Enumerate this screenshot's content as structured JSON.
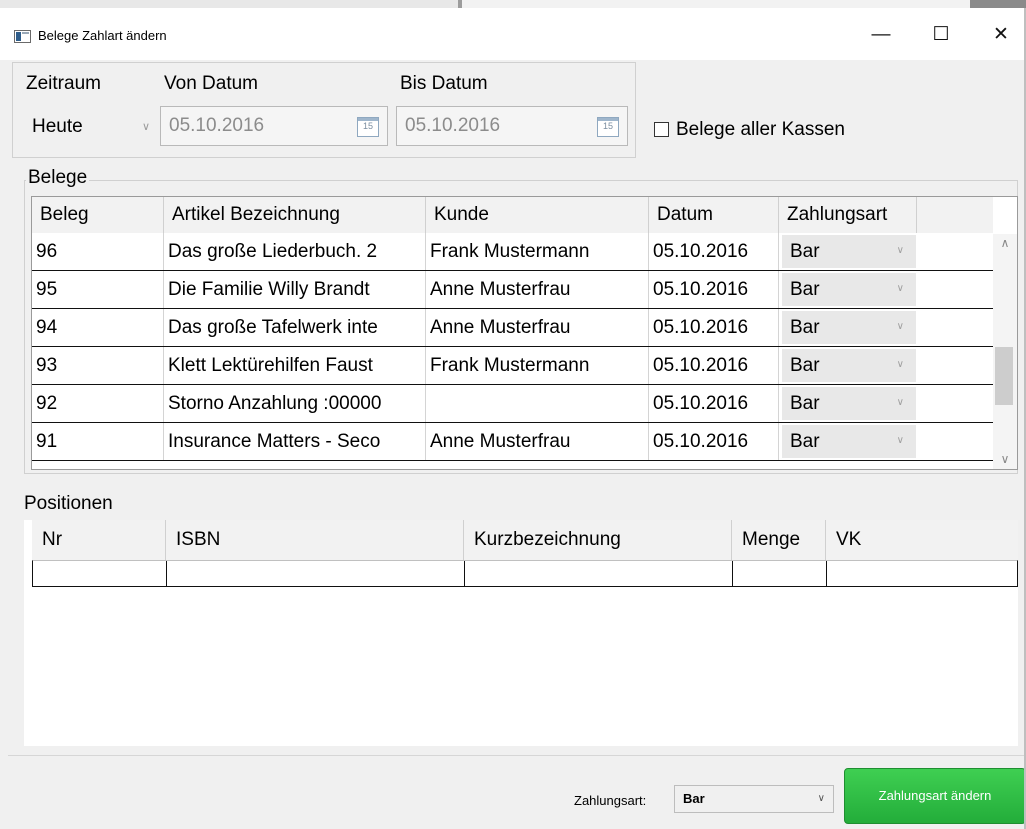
{
  "window": {
    "title": "Belege Zahlart ändern",
    "minimize_glyph": "—",
    "maximize_glyph": "☐",
    "close_glyph": "✕",
    "icon": "app-window-icon"
  },
  "filter": {
    "zeitraum_label": "Zeitraum",
    "von_label": "Von Datum",
    "bis_label": "Bis Datum",
    "zeitraum_value": "Heute",
    "von_value": "05.10.2016",
    "bis_value": "05.10.2016",
    "calendar_icon_text": "15",
    "alle_kassen_label": "Belege aller Kassen",
    "alle_kassen_checked": false
  },
  "belege": {
    "title": "Belege",
    "columns": [
      "Beleg",
      "Artikel Bezeichnung",
      "Kunde",
      "Datum",
      "Zahlungsart"
    ],
    "rows": [
      {
        "beleg": "96",
        "artikel": "Das große Liederbuch. 2",
        "kunde": "Frank Mustermann",
        "datum": "05.10.2016",
        "zahlungsart": "Bar"
      },
      {
        "beleg": "95",
        "artikel": "Die Familie Willy Brandt",
        "kunde": "Anne Musterfrau",
        "datum": "05.10.2016",
        "zahlungsart": "Bar"
      },
      {
        "beleg": "94",
        "artikel": "Das große Tafelwerk inte",
        "kunde": "Anne Musterfrau",
        "datum": "05.10.2016",
        "zahlungsart": "Bar"
      },
      {
        "beleg": "93",
        "artikel": "Klett Lektürehilfen Faust",
        "kunde": "Frank Mustermann",
        "datum": "05.10.2016",
        "zahlungsart": "Bar"
      },
      {
        "beleg": "92",
        "artikel": "Storno Anzahlung :00000",
        "kunde": "",
        "datum": "05.10.2016",
        "zahlungsart": "Bar"
      },
      {
        "beleg": "91",
        "artikel": "Insurance Matters - Seco",
        "kunde": "Anne Musterfrau",
        "datum": "05.10.2016",
        "zahlungsart": "Bar"
      }
    ]
  },
  "positionen": {
    "title": "Positionen",
    "columns": [
      "Nr",
      "ISBN",
      "Kurzbezeichnung",
      "Menge",
      "VK"
    ]
  },
  "footer": {
    "zahlungsart_label": "Zahlungsart:",
    "zahlungsart_value": "Bar",
    "change_button_label": "Zahlungsart ändern"
  },
  "colors": {
    "button_green": "#2bbf43",
    "window_bg": "#f0f0f0"
  }
}
